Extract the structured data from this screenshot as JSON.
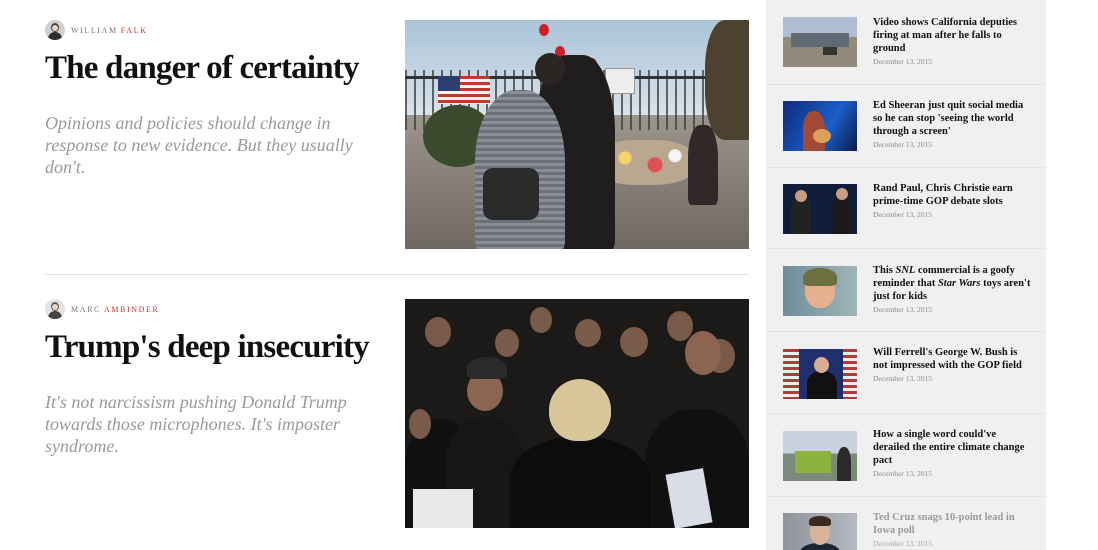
{
  "articles": [
    {
      "author_first": "William",
      "author_last": "Falk",
      "title": "The danger of certainty",
      "dek": "Opinions and policies should change in response to new evidence. But they usually don't."
    },
    {
      "author_first": "Marc",
      "author_last": "Ambinder",
      "title": "Trump's deep insecurity",
      "dek": "It's not narcissism pushing Donald Trump towards those microphones. It's imposter syndrome."
    }
  ],
  "rail": [
    {
      "title": "Video shows California deputies firing at man after he falls to ground",
      "date": "December 13, 2015"
    },
    {
      "title": "Ed Sheeran just quit social media so he can stop 'seeing the world through a screen'",
      "date": "December 13, 2015"
    },
    {
      "title": "Rand Paul, Chris Christie earn prime-time GOP debate slots",
      "date": "December 13, 2015"
    },
    {
      "title_pre": "This ",
      "title_em1": "SNL",
      "title_mid": " commercial is a goofy reminder that ",
      "title_em2": "Star Wars",
      "title_post": " toys aren't just for kids",
      "date": "December 13, 2015"
    },
    {
      "title": "Will Ferrell's George W. Bush is not impressed with the GOP field",
      "date": "December 13, 2015"
    },
    {
      "title": "How a single word could've derailed the entire climate change pact",
      "date": "December 13, 2015"
    },
    {
      "title": "Ted Cruz snags 10-point lead in Iowa poll",
      "date": "December 13, 2015"
    }
  ],
  "colors": {
    "accent_red": "#d0322d",
    "rail_bg": "#f0f0f0",
    "dek_gray": "#9a9a9a"
  }
}
